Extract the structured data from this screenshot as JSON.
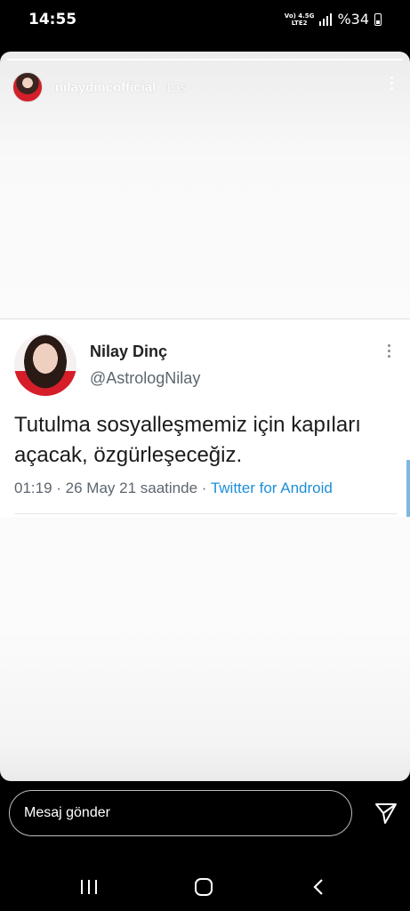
{
  "status_bar": {
    "time": "14:55",
    "network_top": "Vo) 4.5G",
    "network_bottom": "LTE2",
    "battery": "%34"
  },
  "story": {
    "username": "nilaydincofficial",
    "time_ago": "13s",
    "tweet": {
      "name": "Nilay Dinç",
      "handle": "@AstrologNilay",
      "text": "Tutulma sosyalleşmemiz için kapıları açacak, özgürleşeceğiz.",
      "meta": "01:19 · 26 May 21 saatinde · ",
      "source": "Twitter for Android"
    }
  },
  "reply": {
    "placeholder": "Mesaj gönder"
  },
  "icons": {
    "menu": "more-vertical-icon",
    "send": "send-icon",
    "recents": "recents-icon",
    "home": "home-icon",
    "back": "back-icon"
  }
}
